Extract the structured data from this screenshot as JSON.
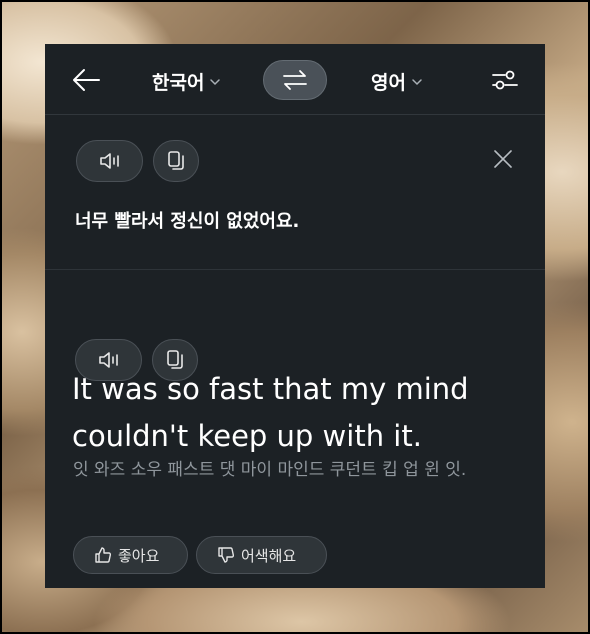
{
  "header": {
    "source_lang": "한국어",
    "target_lang": "영어"
  },
  "source": {
    "text": "너무 빨라서 정신이 없었어요."
  },
  "result": {
    "translation": "It was so fast that my mind couldn't keep up with it.",
    "pronunciation": "잇 와즈 소우 패스트 댓 마이 마인드 쿠던트 킵 업 윈 잇."
  },
  "feedback": {
    "like_label": "좋아요",
    "dislike_label": "어색해요"
  },
  "colors": {
    "panel_bg": "#1c2125",
    "pill_bg": "#2f3539",
    "swap_bg": "#4a5158",
    "muted_text": "#8f969c"
  }
}
